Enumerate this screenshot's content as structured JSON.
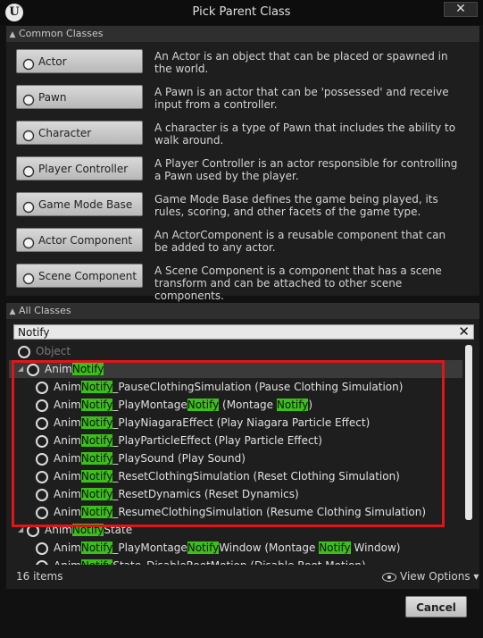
{
  "window": {
    "title": "Pick Parent Class",
    "logo": "U",
    "close": "✕"
  },
  "common": {
    "header": "Common Classes",
    "items": [
      {
        "label": "Actor",
        "icon": "actor-icon",
        "desc": "An Actor is an object that can be placed or spawned in the world."
      },
      {
        "label": "Pawn",
        "icon": "pawn-icon",
        "desc": "A Pawn is an actor that can be 'possessed' and receive input from a controller."
      },
      {
        "label": "Character",
        "icon": "character-icon",
        "desc": "A character is a type of Pawn that includes the ability to walk around."
      },
      {
        "label": "Player Controller",
        "icon": "player-controller-icon",
        "desc": "A Player Controller is an actor responsible for controlling a Pawn used by the player."
      },
      {
        "label": "Game Mode Base",
        "icon": "game-mode-icon",
        "desc": "Game Mode Base defines the game being played, its rules, scoring, and other facets of the game type."
      },
      {
        "label": "Actor Component",
        "icon": "actor-component-icon",
        "desc": "An ActorComponent is a reusable component that can be added to any actor."
      },
      {
        "label": "Scene Component",
        "icon": "scene-component-icon",
        "desc": "A Scene Component is a component that has a scene transform and can be attached to other scene components."
      }
    ]
  },
  "all": {
    "header": "All Classes",
    "search_value": "Notify",
    "search_clear": "✕",
    "rows": [
      {
        "segments": [
          "Object"
        ]
      },
      {
        "segments": [
          "Anim",
          "Notify"
        ]
      },
      {
        "segments": [
          "Anim",
          "Notify",
          "_PauseClothingSimulation (Pause Clothing Simulation)"
        ]
      },
      {
        "segments": [
          "Anim",
          "Notify",
          "_PlayMontage",
          "Notify",
          " (Montage ",
          "Notify",
          ")"
        ]
      },
      {
        "segments": [
          "Anim",
          "Notify",
          "_PlayNiagaraEffect (Play Niagara Particle Effect)"
        ]
      },
      {
        "segments": [
          "Anim",
          "Notify",
          "_PlayParticleEffect (Play Particle Effect)"
        ]
      },
      {
        "segments": [
          "Anim",
          "Notify",
          "_PlaySound (Play Sound)"
        ]
      },
      {
        "segments": [
          "Anim",
          "Notify",
          "_ResetClothingSimulation (Reset Clothing Simulation)"
        ]
      },
      {
        "segments": [
          "Anim",
          "Notify",
          "_ResetDynamics (Reset Dynamics)"
        ]
      },
      {
        "segments": [
          "Anim",
          "Notify",
          "_ResumeClothingSimulation (Resume Clothing Simulation)"
        ]
      },
      {
        "segments": [
          "Anim",
          "Notify",
          "State"
        ]
      },
      {
        "segments": [
          "Anim",
          "Notify",
          "_PlayMontage",
          "Notify",
          "Window (Montage ",
          "Notify",
          " Window)"
        ]
      },
      {
        "segments": [
          "Anim",
          "Notify",
          "State_DisableRootMotion (Disable Root Motion)"
        ]
      }
    ],
    "count": "16 items",
    "view_options": "View Options"
  },
  "footer": {
    "cancel": "Cancel"
  },
  "colors": {
    "highlight": "#3bbf1a",
    "annotation_box": "#e0151b"
  }
}
